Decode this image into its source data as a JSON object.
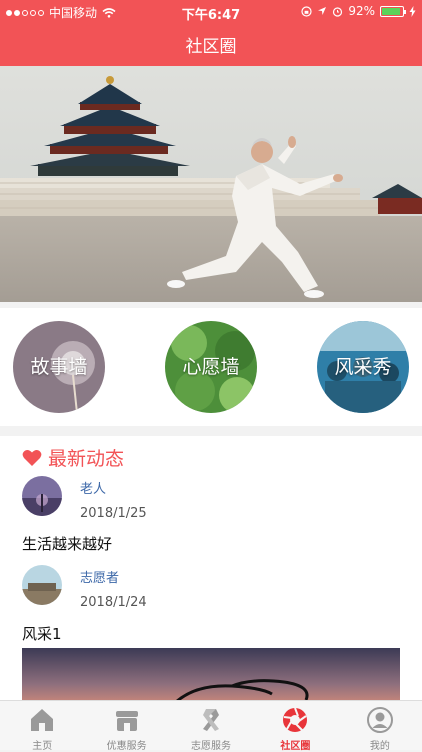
{
  "status": {
    "carrier": "中国移动",
    "time": "下午6:47",
    "battery": "92%",
    "battery_level": 0.92
  },
  "nav": {
    "title": "社区圈"
  },
  "categories": [
    {
      "label": "故事墙",
      "icon": "dandelion-photo"
    },
    {
      "label": "心愿墙",
      "icon": "leaves-photo"
    },
    {
      "label": "风采秀",
      "icon": "group-photo"
    }
  ],
  "feed": {
    "title": "最新动态",
    "posts": [
      {
        "user": "老人",
        "date": "2018/1/25",
        "text": "生活越来越好"
      },
      {
        "user": "志愿者",
        "date": "2018/1/24",
        "text": "风采1"
      }
    ]
  },
  "tabs": [
    {
      "label": "主页",
      "icon": "home-icon",
      "active": false
    },
    {
      "label": "优惠服务",
      "icon": "shop-icon",
      "active": false
    },
    {
      "label": "志愿服务",
      "icon": "volunteer-ribbon-icon",
      "active": false
    },
    {
      "label": "社区圈",
      "icon": "camera-shutter-icon",
      "active": true
    },
    {
      "label": "我的",
      "icon": "user-icon",
      "active": false
    }
  ],
  "colors": {
    "accent": "#f25356",
    "link": "#3d68a8",
    "tab_active": "#e8353a"
  }
}
